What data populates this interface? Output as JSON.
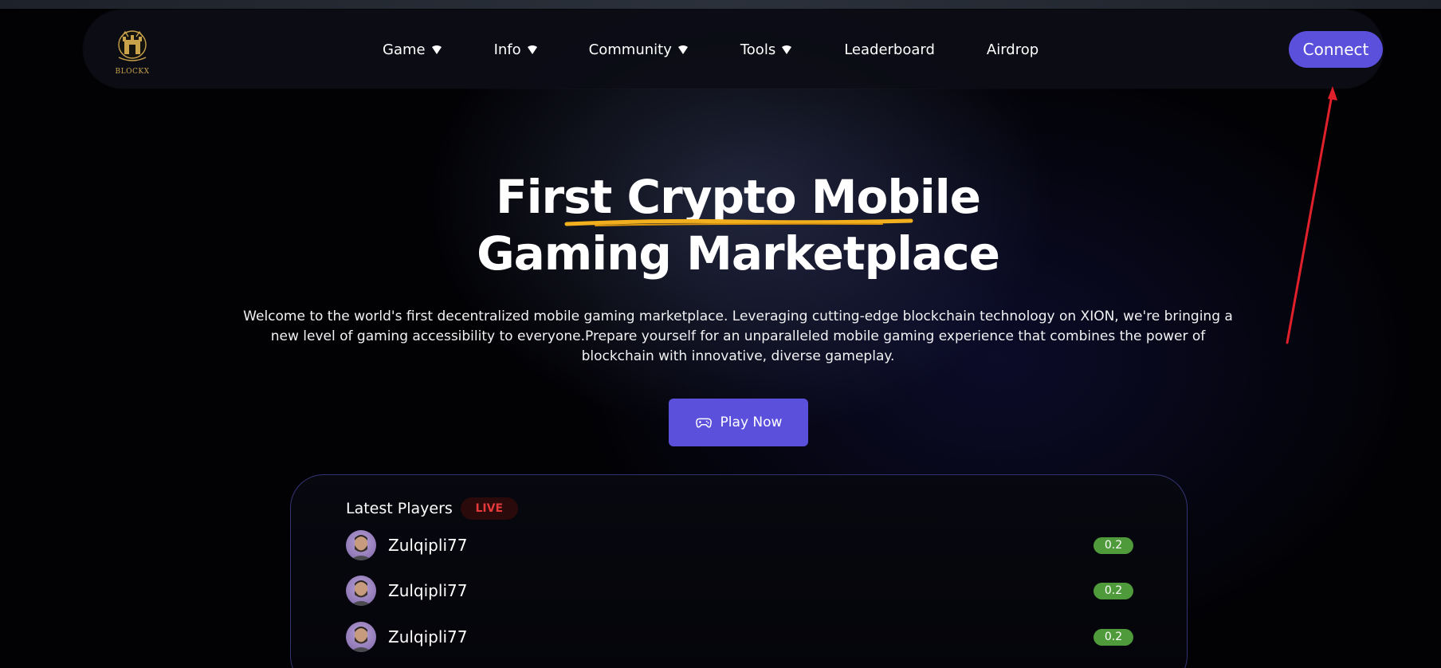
{
  "nav": {
    "logo_text": "BLOCKX",
    "items": [
      {
        "label": "Game",
        "has_dropdown": true
      },
      {
        "label": "Info",
        "has_dropdown": true
      },
      {
        "label": "Community",
        "has_dropdown": true
      },
      {
        "label": "Tools",
        "has_dropdown": true
      },
      {
        "label": "Leaderboard",
        "has_dropdown": false
      },
      {
        "label": "Airdrop",
        "has_dropdown": false
      }
    ],
    "connect_label": "Connect"
  },
  "hero": {
    "title_line1": "First Crypto Mobile",
    "title_line2": "Gaming Marketplace",
    "description": "Welcome to the world's first decentralized mobile gaming marketplace. Leveraging cutting-edge blockchain technology on XION, we're bringing a new level of gaming accessibility to everyone.Prepare yourself for an unparalleled mobile gaming experience that combines the power of blockchain with innovative, diverse gameplay.",
    "play_label": "Play Now",
    "play_icon": "gamepad-icon"
  },
  "players": {
    "title": "Latest Players",
    "live_label": "LIVE",
    "rows": [
      {
        "name": "Zulqipli77",
        "amount": "0.2"
      },
      {
        "name": "Zulqipli77",
        "amount": "0.2"
      },
      {
        "name": "Zulqipli77",
        "amount": "0.2"
      }
    ]
  },
  "colors": {
    "accent": "#5b50dc",
    "live_text": "#e5383b",
    "amount_badge": "#4f9a3a",
    "underline": "#f2b01e",
    "annotation_arrow": "#e0202a"
  }
}
